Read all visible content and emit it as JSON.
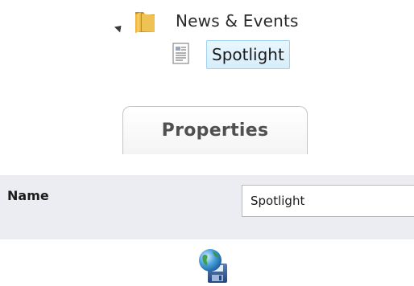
{
  "tree": {
    "folder_label": "News & Events",
    "item_label": "Spotlight"
  },
  "properties_tab": {
    "label": "Properties"
  },
  "name_row": {
    "label": "Name",
    "value": "Spotlight"
  },
  "icons": {
    "expand": "expanded-arrow-icon",
    "folder": "folder-icon",
    "page": "page-icon",
    "save": "globe-save-icon"
  },
  "colors": {
    "selection_border": "#9fd0ee",
    "selection_fill": "#d6eefb",
    "row_background": "#ececf3",
    "folder_yellow": "#f0c24a"
  }
}
